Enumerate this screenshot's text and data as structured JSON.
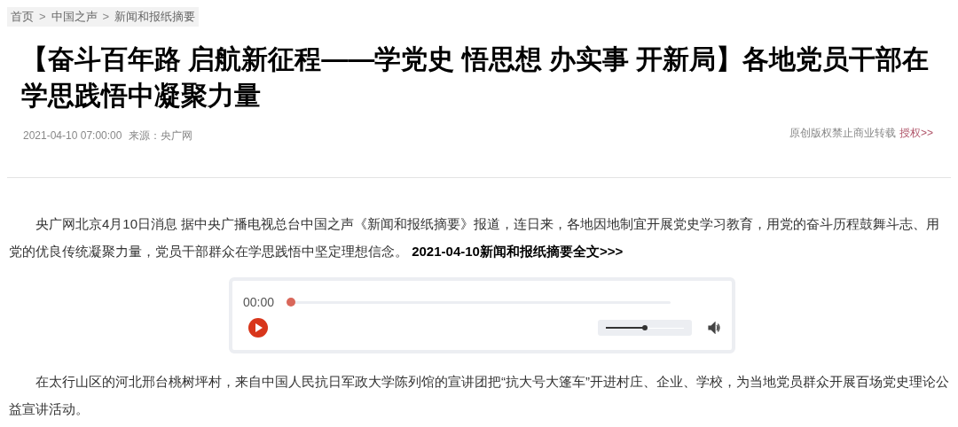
{
  "breadcrumb": {
    "items": [
      "首页",
      "中国之声",
      "新闻和报纸摘要"
    ],
    "separator": ">"
  },
  "article": {
    "title": "【奋斗百年路 启航新征程——学党史 悟思想 办实事 开新局】各地党员干部在学思践悟中凝聚力量",
    "date": "2021-04-10 07:00:00",
    "source": "来源：央广网",
    "copyright": "原创版权禁止商业转载",
    "authorize_link": "授权>>",
    "paragraphs": [
      {
        "text": "央广网北京4月10日消息 据中央广播电视总台中国之声《新闻和报纸摘要》报道，连日来，各地因地制宜开展党史学习教育，用党的奋斗历程鼓舞斗志、用党的优良传统凝聚力量，党员干部群众在学思践悟中坚定理想信念。",
        "link": "2021-04-10新闻和报纸摘要全文>>>"
      },
      {
        "text": "在太行山区的河北邢台桃树坪村，来自中国人民抗日军政大学陈列馆的宣讲团把“抗大号大篷车”开进村庄、企业、学校，为当地党员群众开展百场党史理论公益宣讲活动。"
      }
    ],
    "audio_player": {
      "time": "00:00",
      "progress": {
        "level": 0
      },
      "volume": {
        "level": 0.5
      }
    }
  }
}
